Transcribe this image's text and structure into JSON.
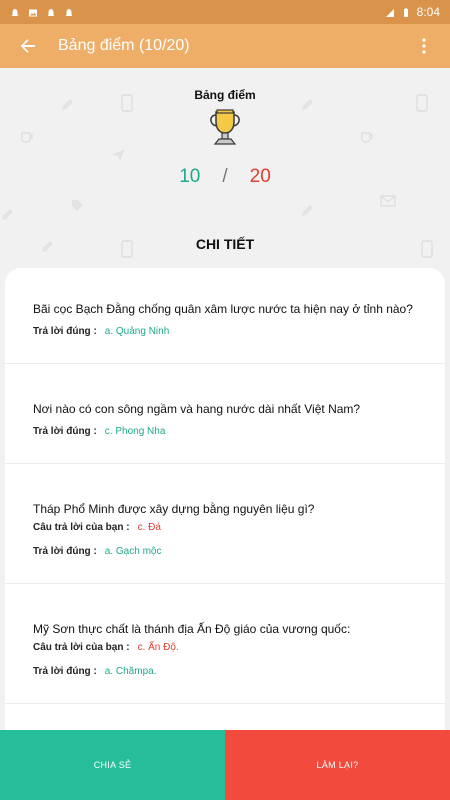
{
  "status_bar": {
    "time": "8:04"
  },
  "app_bar": {
    "title": "Bảng điểm (10/20)"
  },
  "score": {
    "title": "Bảng điểm",
    "correct": "10",
    "separator": "/",
    "total": "20"
  },
  "detail_title": "CHI TIẾT",
  "labels": {
    "your_answer": "Câu trả lời của bạn :",
    "correct_answer": "Trả lời đúng :"
  },
  "questions": [
    {
      "text": "Bãi cọc Bạch Đằng chống quân xâm lược nước ta hiện nay ở tỉnh nào?",
      "correct": "a. Quảng Ninh"
    },
    {
      "text": "Nơi nào có con sông ngầm và hang nước dài nhất Việt Nam?",
      "correct": "c. Phong Nha"
    },
    {
      "text": "Tháp Phổ Minh được xây dựng bằng nguyên liệu gì?",
      "yours": "c. Đá",
      "correct": "a. Gạch mộc"
    },
    {
      "text": "Mỹ Sơn thực chất là thánh địa Ấn Độ giáo của vương quốc:",
      "yours": "c. Ấn Độ.",
      "correct": "a. Chămpa."
    }
  ],
  "buttons": {
    "share": "CHIA SẺ",
    "retry": "LÀM LẠI?"
  },
  "colors": {
    "primary": "#efae68",
    "status": "#d9934a",
    "correct": "#1fa98c",
    "wrong": "#e63c2e",
    "share_bg": "#26bd9b",
    "retry_bg": "#f24a3d"
  }
}
